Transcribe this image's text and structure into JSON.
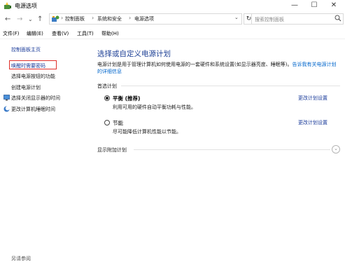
{
  "window": {
    "title": "电源选项",
    "controls": [
      "—",
      "☐",
      "✕"
    ]
  },
  "nav": {
    "back": "←",
    "forward": "→",
    "dropdown": "⌄",
    "up": "↑",
    "breadcrumb": [
      "控制面板",
      "系统和安全",
      "电源选项"
    ],
    "separator": "›",
    "refresh": "↻",
    "search_placeholder": "搜索控制面板"
  },
  "menu": [
    "文件(F)",
    "编辑(E)",
    "查看(V)",
    "工具(T)",
    "帮助(H)"
  ],
  "sidebar": {
    "home": "控制面板主页",
    "items": [
      "唤醒时需要密码",
      "选择电源按钮的功能",
      "创建电源计划",
      "选择关闭显示器的时间",
      "更改计算机睡眠时间"
    ],
    "see_also": "另请参阅"
  },
  "main": {
    "heading": "选择或自定义电源计划",
    "desc_text": "电源计划是用于管理计算机如何使用电源的一套硬件和系统设置(如显示器亮度、睡眠等)。",
    "desc_link": "告诉我有关电源计划的详细信息",
    "preferred_label": "首选计划",
    "plans": [
      {
        "name": "平衡 (推荐)",
        "desc": "利用可用的硬件自动平衡功耗与性能。",
        "link": "更改计划设置",
        "selected": true
      },
      {
        "name": "节能",
        "desc": "尽可能降低计算机性能以节能。",
        "link": "更改计划设置",
        "selected": false
      }
    ],
    "more_label": "显示附加计划",
    "expand": "⌄"
  },
  "colors": {
    "link": "#1a3b9a",
    "heading": "#1c3f95",
    "highlight": "#e0302a"
  }
}
